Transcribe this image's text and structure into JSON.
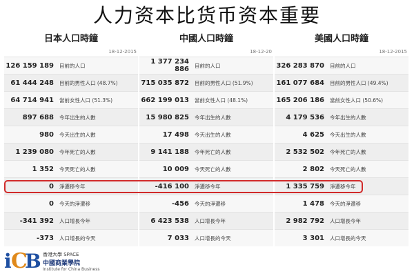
{
  "title": "人力资本比货币资本重要",
  "columns": [
    {
      "header": "日本人口時鐘",
      "date": "18-12-2015",
      "rows": [
        {
          "value": "126 159 189",
          "label": "目前的人口"
        },
        {
          "value": "61 444 248",
          "label": "目前的男性人口 (48.7%)"
        },
        {
          "value": "64 714 941",
          "label": "當前女性人口 (51.3%)"
        },
        {
          "value": "897 688",
          "label": "今年出生的人數"
        },
        {
          "value": "980",
          "label": "今天出生的人數"
        },
        {
          "value": "1 239 080",
          "label": "今年死亡的人數"
        },
        {
          "value": "1 352",
          "label": "今天死亡的人數"
        },
        {
          "value": "0",
          "label": "淨遷移今年"
        },
        {
          "value": "0",
          "label": "今天的淨遷移"
        },
        {
          "value": "-341 392",
          "label": "人口增長今年"
        },
        {
          "value": "-373",
          "label": "人口增長的今天"
        }
      ]
    },
    {
      "header": "中國人口時鐘",
      "date": "18-12-20",
      "rows": [
        {
          "value": "1 377 234 886",
          "label": "目前的人口"
        },
        {
          "value": "715 035 872",
          "label": "目前的男性人口 (51.9%)"
        },
        {
          "value": "662 199 013",
          "label": "當前女性人口 (48.1%)"
        },
        {
          "value": "15 980 825",
          "label": "今年出生的人數"
        },
        {
          "value": "17 498",
          "label": "今天出生的人數"
        },
        {
          "value": "9 141 188",
          "label": "今年死亡的人數"
        },
        {
          "value": "10 009",
          "label": "今天死亡的人數"
        },
        {
          "value": "-416 100",
          "label": "淨遷移今年"
        },
        {
          "value": "-456",
          "label": "今天的淨遷移"
        },
        {
          "value": "6 423 538",
          "label": "人口增長今年"
        },
        {
          "value": "7 033",
          "label": "人口增長的今天"
        }
      ]
    },
    {
      "header": "美國人口時鐘",
      "date": "18-12-2015",
      "rows": [
        {
          "value": "326 283 870",
          "label": "目前的人口"
        },
        {
          "value": "161 077 684",
          "label": "目前的男性人口 (49.4%)"
        },
        {
          "value": "165 206 186",
          "label": "當前女性人口 (50.6%)"
        },
        {
          "value": "4 179 536",
          "label": "今年出生的人數"
        },
        {
          "value": "4 625",
          "label": "今天出生的人數"
        },
        {
          "value": "2 532 502",
          "label": "今年死亡的人數"
        },
        {
          "value": "2 802",
          "label": "今天死亡的人數"
        },
        {
          "value": "1 335 759",
          "label": "淨遷移今年"
        },
        {
          "value": "1 478",
          "label": "今天的淨遷移"
        },
        {
          "value": "2 982 792",
          "label": "人口增長今年"
        },
        {
          "value": "3 301",
          "label": "人口增長的今天"
        }
      ]
    }
  ],
  "logo": {
    "mark_i": "i",
    "mark_c": "C",
    "mark_b": "B",
    "line1": "香港大學 SPACE",
    "line2": "中國商業學院",
    "line3": "Institute for China Business"
  },
  "colors": {
    "highlight": "#d12a2a",
    "logo_blue": "#1e4fa1",
    "logo_orange": "#e08a1c"
  }
}
